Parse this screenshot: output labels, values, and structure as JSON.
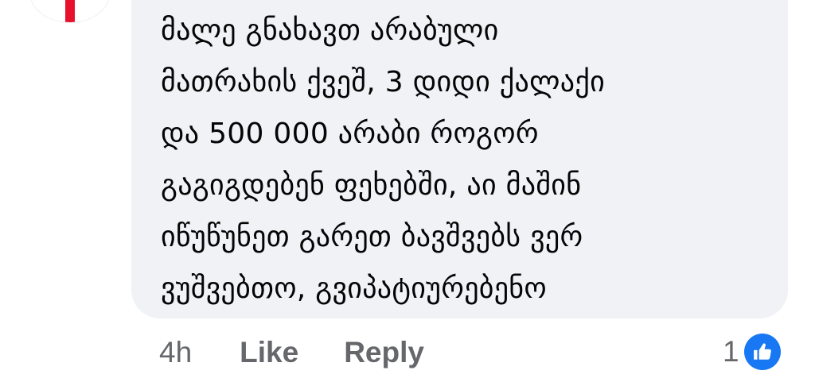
{
  "comment": {
    "text": "მალე გნახავთ არაბული\nმათრახის ქვეშ, 3 დიდი ქალაქი\nდა 500 000 არაბი როგორ\nგაგიგდებენ ფეხებში, აი მაშინ\nიწუწუნეთ გარეთ ბავშვებს ვერ\nვუშვებთო, გვიპატიურებენო",
    "avatar_icon": "georgian-flag-avatar"
  },
  "actions": {
    "time": "4h",
    "like_label": "Like",
    "reply_label": "Reply"
  },
  "reactions": {
    "count": "1",
    "icon": "thumbs-up-icon",
    "color": "#1877f2"
  },
  "colors": {
    "bubble": "#f0f2f5",
    "text": "#050505",
    "secondary": "#65676b"
  }
}
